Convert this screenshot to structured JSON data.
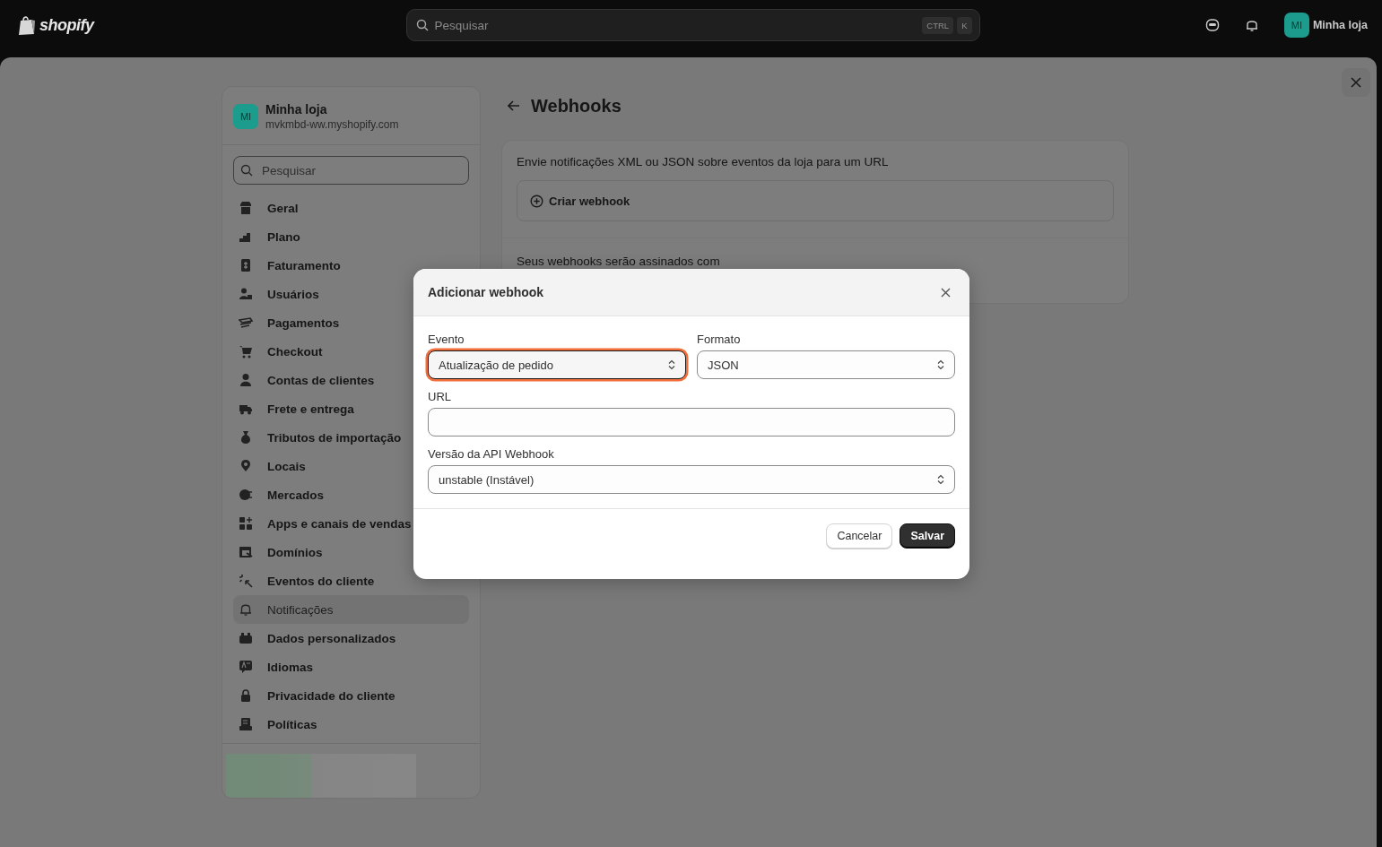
{
  "topbar": {
    "logo": "shopify",
    "search": {
      "placeholder": "Pesquisar",
      "keys": [
        "CTRL",
        "K"
      ]
    },
    "avatar": "MI",
    "store": "Minha loja"
  },
  "sidebar": {
    "avatar": "MI",
    "store_name": "Minha loja",
    "domain": "mvkmbd-ww.myshopify.com",
    "search": {
      "placeholder": "Pesquisar"
    },
    "items": [
      {
        "label": "Geral",
        "selected": false
      },
      {
        "label": "Plano",
        "selected": false
      },
      {
        "label": "Faturamento",
        "selected": false
      },
      {
        "label": "Usuários",
        "selected": false
      },
      {
        "label": "Pagamentos",
        "selected": false
      },
      {
        "label": "Checkout",
        "selected": false
      },
      {
        "label": "Contas de clientes",
        "selected": false
      },
      {
        "label": "Frete e entrega",
        "selected": false
      },
      {
        "label": "Tributos de importação",
        "selected": false
      },
      {
        "label": "Locais",
        "selected": false
      },
      {
        "label": "Mercados",
        "selected": false
      },
      {
        "label": "Apps e canais de vendas",
        "selected": false
      },
      {
        "label": "Domínios",
        "selected": false
      },
      {
        "label": "Eventos do cliente",
        "selected": false
      },
      {
        "label": "Notificações",
        "selected": true
      },
      {
        "label": "Dados personalizados",
        "selected": false
      },
      {
        "label": "Idiomas",
        "selected": false
      },
      {
        "label": "Privacidade do cliente",
        "selected": false
      },
      {
        "label": "Políticas",
        "selected": false
      }
    ]
  },
  "page": {
    "title": "Webhooks",
    "description": "Envie notificações XML ou JSON sobre eventos da loja para um URL",
    "create_button": "Criar webhook",
    "signed_note": "Seus webhooks serão assinados com"
  },
  "modal": {
    "title": "Adicionar webhook",
    "fields": [
      {
        "kind": "select",
        "label": "Evento",
        "value": "Atualização de pedido",
        "focused": true
      },
      {
        "kind": "select",
        "label": "Formato",
        "value": "JSON",
        "focused": false
      },
      {
        "kind": "text",
        "label": "URL",
        "focused": false
      },
      {
        "kind": "select",
        "label": "Versão da API Webhook",
        "value": "unstable (Instável)",
        "focused": false
      }
    ],
    "buttons": [
      {
        "label": "Cancelar",
        "primary": false
      },
      {
        "label": "Salvar",
        "primary": true
      }
    ]
  }
}
